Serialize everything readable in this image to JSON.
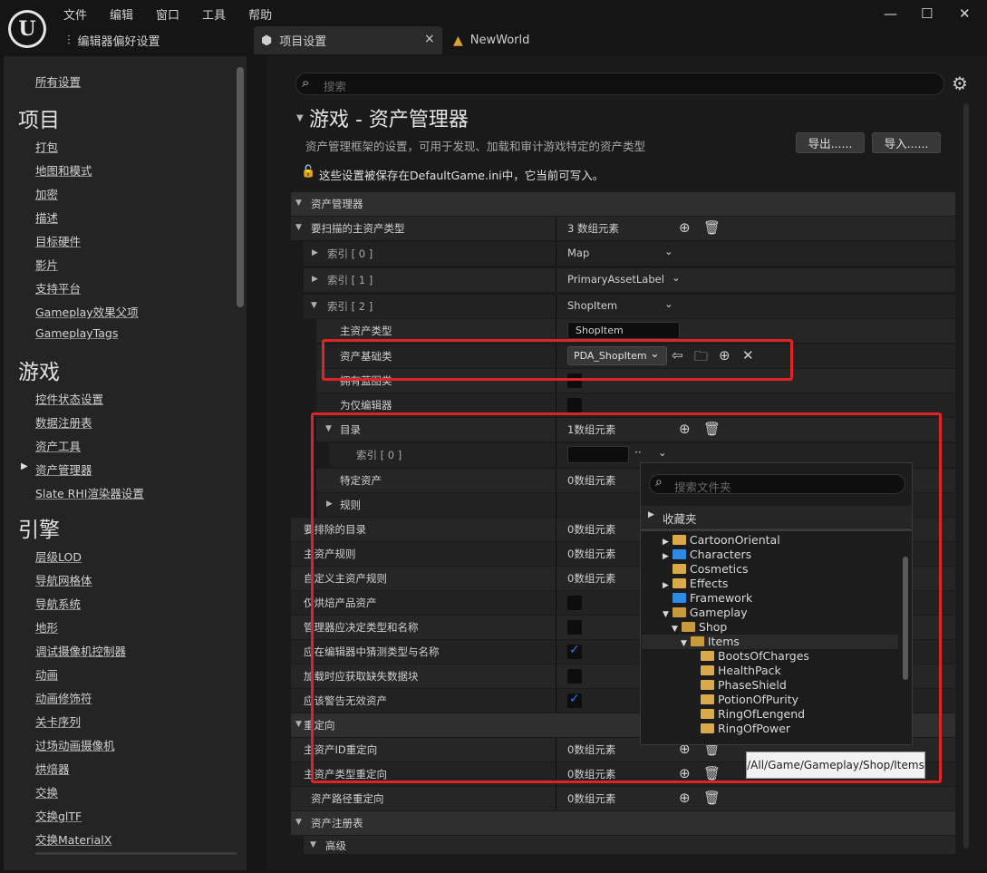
{
  "menu": [
    "文件",
    "编辑",
    "窗口",
    "工具",
    "帮助"
  ],
  "window_controls": {
    "min": "—",
    "max": "☐",
    "close": "✕"
  },
  "tabs": [
    {
      "label": "编辑器偏好设置",
      "icon": "sliders-icon"
    },
    {
      "label": "项目设置",
      "icon": "project-settings-icon",
      "close": "×"
    },
    {
      "label": "NewWorld",
      "icon": "level-icon"
    }
  ],
  "left_nav": {
    "all_settings": "所有设置",
    "sections": [
      {
        "title": "项目",
        "items": [
          "打包",
          "地图和模式",
          "加密",
          "描述",
          "目标硬件",
          "影片",
          "支持平台",
          "Gameplay效果父项",
          "GameplayTags"
        ]
      },
      {
        "title": "游戏",
        "items": [
          "控件状态设置",
          "数据注册表",
          "资产工具",
          "资产管理器",
          "Slate RHI渲染器设置"
        ]
      },
      {
        "title": "引擎",
        "items": [
          "层级LOD",
          "导航网格体",
          "导航系统",
          "地形",
          "调试摄像机控制器",
          "动画",
          "动画修饰符",
          "关卡序列",
          "过场动画摄像机",
          "烘焙器",
          "交换",
          "交换glTF",
          "交换MaterialX"
        ]
      }
    ],
    "active_item": "资产管理器"
  },
  "search": {
    "placeholder": "搜索"
  },
  "section": {
    "title": "游戏 - 资产管理器",
    "description": "资产管理框架的设置，可用于发现、加载和审计游戏特定的资产类型",
    "export_label": "导出......",
    "import_label": "导入......",
    "writable_note": "这些设置被保存在DefaultGame.ini中，它当前可写入。"
  },
  "grid": {
    "cat_asset_manager": "资产管理器",
    "primary_types_label": "要扫描的主资产类型",
    "primary_types_value": "3 数组元素",
    "index0": "索引 [ 0 ]",
    "index0_value": "Map",
    "index1": "索引 [ 1 ]",
    "index1_value": "PrimaryAssetLabel",
    "index2": "索引 [ 2 ]",
    "index2_value": "ShopItem",
    "primary_type_label": "主资产类型",
    "primary_type_value": "ShopItem",
    "base_class_label": "资产基础类",
    "base_class_value": "PDA_ShopItem",
    "has_blueprint_label": "拥有蓝图类",
    "editor_only_label": "为仅编辑器",
    "directories_label": "目录",
    "directories_value": "1数组元素",
    "dir_index0": "索引 [ 0 ]",
    "specific_assets_label": "特定资产",
    "specific_assets_value": "0数组元素",
    "rules_label": "规则",
    "excluded_dirs_label": "要排除的目录",
    "excluded_dirs_value": "0数组元素",
    "primary_rules_label": "主资产规则",
    "primary_rules_value": "0数组元素",
    "custom_rules_label": "自定义主资产规则",
    "custom_rules_value": "0数组元素",
    "cook_only_label": "仅烘焙产品资产",
    "manager_decides_label": "管理器应决定类型和名称",
    "guess_in_editor_label": "应在编辑器中猜测类型与名称",
    "fetch_missing_label": "加载时应获取缺失数据块",
    "warn_invalid_label": "应该警告无效资产",
    "cat_redirects": "重定向",
    "id_redirects_label": "主资产ID重定向",
    "id_redirects_value": "0数组元素",
    "type_redirects_label": "主资产类型重定向",
    "type_redirects_value": "0数组元素",
    "path_redirects_label": "资产路径重定向",
    "path_redirects_value": "0数组元素",
    "cat_registry": "资产注册表",
    "advanced_label": "高级"
  },
  "checkboxes": {
    "cook_only": false,
    "manager_decides": false,
    "guess_in_editor": true,
    "fetch_missing": false,
    "warn_invalid": true,
    "has_blueprint": false,
    "editor_only": false
  },
  "folder_picker": {
    "search_placeholder": "搜索文件夹",
    "favorites": "收藏夹",
    "tree": [
      "CartoonOriental",
      "Characters",
      "Cosmetics",
      "Effects",
      "Framework",
      "Gameplay",
      "Shop",
      "Items",
      "BootsOfCharges",
      "HealthPack",
      "PhaseShield",
      "PotionOfPurity",
      "RingOfLengend",
      "RingOfPower"
    ],
    "tooltip": "/All/Game/Gameplay/Shop/Items"
  },
  "colors": {
    "highlight_box": "#e02424",
    "checkbox_checked": "#2b7de9",
    "folder": "#d9a94a",
    "folder_blue": "#2f8ae5"
  }
}
